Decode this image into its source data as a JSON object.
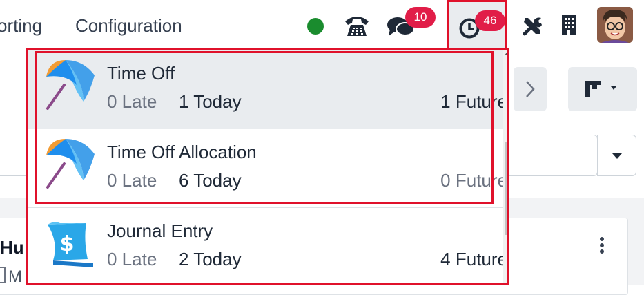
{
  "navbar": {
    "menu_items": [
      "orting",
      "Configuration"
    ],
    "chat_badge": "10",
    "activity_badge": "46"
  },
  "colors": {
    "accent_red": "#e0112b",
    "badge": "#e11d48",
    "presence_online": "#1a8c2e"
  },
  "background": {
    "card_title": "Hu",
    "card_sub": "M"
  },
  "activities": [
    {
      "name": "Time Off",
      "icon": "umbrella-icon",
      "late": "0 Late",
      "today": "1 Today",
      "future": "1 Future"
    },
    {
      "name": "Time Off Allocation",
      "icon": "umbrella-icon",
      "late": "0 Late",
      "today": "6 Today",
      "future": "0 Future"
    },
    {
      "name": "Journal Entry",
      "icon": "dollar-document-icon",
      "late": "0 Late",
      "today": "2 Today",
      "future": "4 Future"
    }
  ]
}
